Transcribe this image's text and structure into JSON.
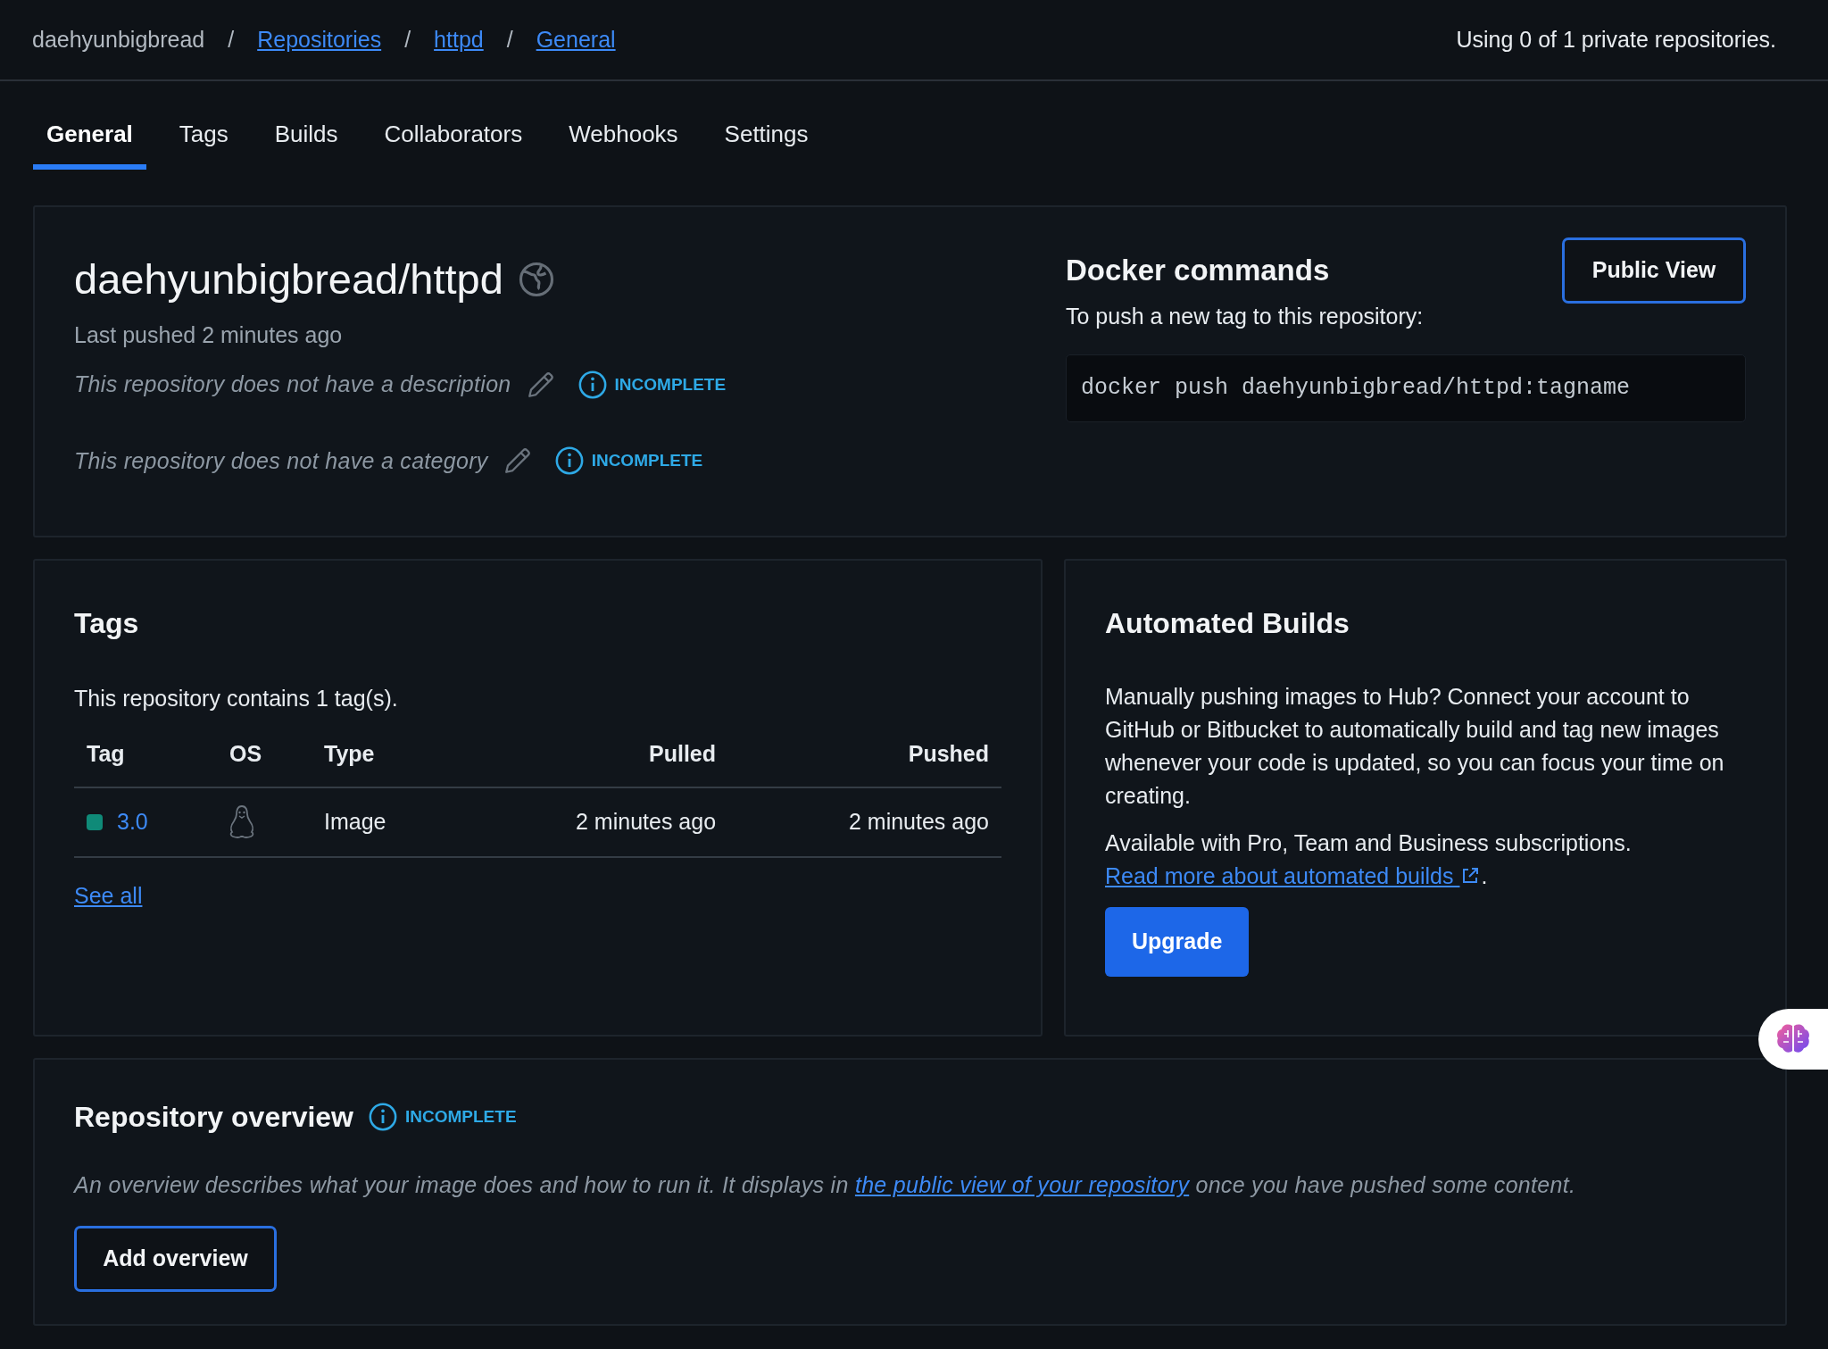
{
  "breadcrumb_separator": "/",
  "breadcrumb": [
    {
      "label": "daehyunbigbread",
      "link": false
    },
    {
      "label": "Repositories",
      "link": true
    },
    {
      "label": "httpd",
      "link": true
    },
    {
      "label": "General",
      "link": true
    }
  ],
  "usage": "Using 0 of 1 private repositories.",
  "tabs": [
    {
      "label": "General",
      "selected": true
    },
    {
      "label": "Tags",
      "selected": false
    },
    {
      "label": "Builds",
      "selected": false
    },
    {
      "label": "Collaborators",
      "selected": false
    },
    {
      "label": "Webhooks",
      "selected": false
    },
    {
      "label": "Settings",
      "selected": false
    }
  ],
  "repo": {
    "title": "daehyunbigbread/httpd",
    "last_pushed": "Last pushed 2 minutes ago",
    "fields": [
      {
        "text": "This repository does not have a description",
        "status": "INCOMPLETE"
      },
      {
        "text": "This repository does not have a category",
        "status": "INCOMPLETE"
      }
    ]
  },
  "docker": {
    "title": "Docker commands",
    "hint": "To push a new tag to this repository:",
    "command": "docker push daehyunbigbread/httpd:tagname",
    "button": "Public View"
  },
  "tags": {
    "title": "Tags",
    "summary": "This repository contains 1 tag(s).",
    "columns": [
      "Tag",
      "OS",
      "Type",
      "Pulled",
      "Pushed"
    ],
    "rows": [
      {
        "tag": "3.0",
        "color": "#0f8a78",
        "type": "Image",
        "pulled": "2 minutes ago",
        "pushed": "2 minutes ago"
      }
    ],
    "see_all": "See all"
  },
  "builds": {
    "title": "Automated Builds",
    "text": "Manually pushing images to Hub? Connect your account to GitHub or Bitbucket to automatically build and tag new images whenever your code is updated, so you can focus your time on creating.",
    "availability": "Available with Pro, Team and Business subscriptions.",
    "link": "Read more about automated builds",
    "end": ".",
    "button": "Upgrade"
  },
  "overview": {
    "title": "Repository overview",
    "status": "INCOMPLETE",
    "text_before": "An overview describes what your image does and how to run it. It displays in",
    "link": "the public view of your repository",
    "text_after": "once you have pushed some content.",
    "button": "Add overview"
  }
}
